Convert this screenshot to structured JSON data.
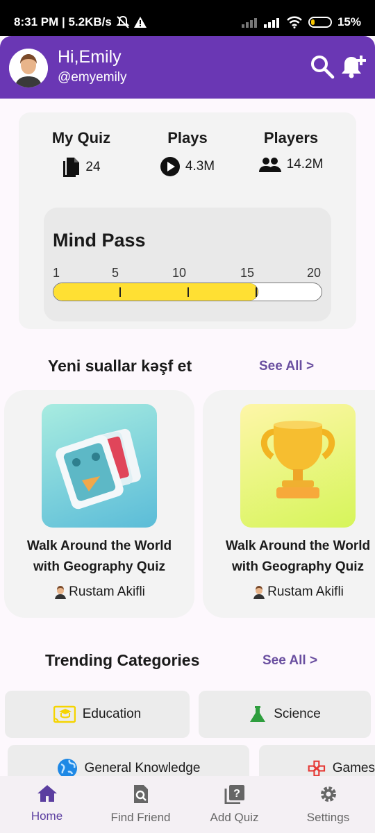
{
  "status": {
    "time_speed": "8:31 PM | 5.2KB/s",
    "battery": "15%"
  },
  "header": {
    "greeting": "Hi,Emily",
    "handle": "@emyemily"
  },
  "stats": {
    "my_quiz_label": "My Quiz",
    "my_quiz_value": "24",
    "plays_label": "Plays",
    "plays_value": "4.3M",
    "players_label": "Players",
    "players_value": "14.2M"
  },
  "mind_pass": {
    "title": "Mind Pass",
    "ticks": [
      "1",
      "5",
      "10",
      "15",
      "20"
    ],
    "level": 15.5,
    "max": 20
  },
  "discover": {
    "title": "Yeni suallar kəşf et",
    "see_all": "See All >",
    "cards": [
      {
        "title_line1": "Walk Around the World",
        "title_line2": "with Geography Quiz",
        "author": "Rustam Akifli"
      },
      {
        "title_line1": "Walk Around the World",
        "title_line2": "with Geography Quiz",
        "author": "Rustam Akifli"
      }
    ]
  },
  "trending": {
    "title": "Trending Categories",
    "see_all": "See All >",
    "categories": [
      {
        "label": "Education",
        "icon": "education-icon",
        "color": "#f5d400"
      },
      {
        "label": "Science",
        "icon": "flask-icon",
        "color": "#2e9e3e"
      },
      {
        "label": "General Knowledge",
        "icon": "globe-icon",
        "color": "#1e88e5"
      },
      {
        "label": "Games",
        "icon": "gamepad-icon",
        "color": "#e53935"
      }
    ]
  },
  "nav": {
    "home": "Home",
    "find_friend": "Find Friend",
    "add_quiz": "Add Quiz",
    "settings": "Settings"
  },
  "colors": {
    "primary": "#6a37b4",
    "accent_text": "#6a4fa0",
    "progress_fill": "#ffe033"
  }
}
